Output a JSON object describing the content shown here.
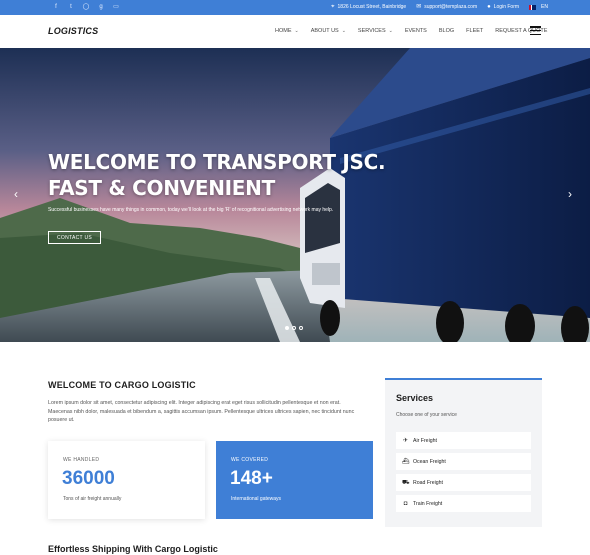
{
  "topbar": {
    "social_icons": [
      "facebook-icon",
      "twitter-icon",
      "github-icon",
      "google-plus-icon",
      "youtube-icon"
    ],
    "social_glyphs": [
      "f",
      "t",
      "◯",
      "g",
      "▭"
    ],
    "address": "1826 Locust Street, Bainbridge",
    "email": "support@templaza.com",
    "login": "Login Form",
    "language": "EN"
  },
  "header": {
    "logo": "LOGISTICS",
    "nav": [
      {
        "label": "HOME",
        "dropdown": true
      },
      {
        "label": "ABOUT US",
        "dropdown": true
      },
      {
        "label": "SERVICES",
        "dropdown": true
      },
      {
        "label": "EVENTS",
        "dropdown": false
      },
      {
        "label": "BLOG",
        "dropdown": false
      },
      {
        "label": "FLEET",
        "dropdown": false
      },
      {
        "label": "REQUEST A QUOTE",
        "dropdown": false
      }
    ]
  },
  "hero": {
    "title_line1": "WELCOME TO TRANSPORT JSC.",
    "title_line2": "FAST & CONVENIENT",
    "subtitle": "Successful businesses have many things in common, today we'll look at the big 'R' of recognitional advertising network may help.",
    "button": "CONTACT US",
    "slides": 3,
    "active_slide": 1
  },
  "welcome": {
    "title": "WELCOME TO CARGO LOGISTIC",
    "text": "Lorem ipsum dolor sit amet, consectetur adipiscing elit. Integer adipiscing erat eget risus sollicitudin pellentesque et non erat. Maecenas nibh dolor, malesuada et bibendum a, sagittis accumsan ipsum. Pellentesque ultrices ultrices sapien, nec tincidunt nunc posuere ut."
  },
  "stats": [
    {
      "label": "WE HANDLED",
      "value": "36000",
      "desc": "Tons of air freight annually"
    },
    {
      "label": "WE COVERED",
      "value": "148+",
      "desc": "International gateways"
    }
  ],
  "services": {
    "title": "Services",
    "subtitle": "Choose one of your service",
    "items": [
      {
        "label": "Air Freight",
        "icon": "plane-icon",
        "glyph": "✈"
      },
      {
        "label": "Ocean Freight",
        "icon": "ship-icon",
        "glyph": "⛴"
      },
      {
        "label": "Road Freight",
        "icon": "truck-icon",
        "glyph": "⛟"
      },
      {
        "label": "Train Freight",
        "icon": "train-icon",
        "glyph": "◘"
      }
    ]
  },
  "section_title": "Effortless Shipping With Cargo Logistic",
  "colors": {
    "accent": "#3f7fd6",
    "dark": "#1e1e1e",
    "panel": "#f3f4f6"
  }
}
